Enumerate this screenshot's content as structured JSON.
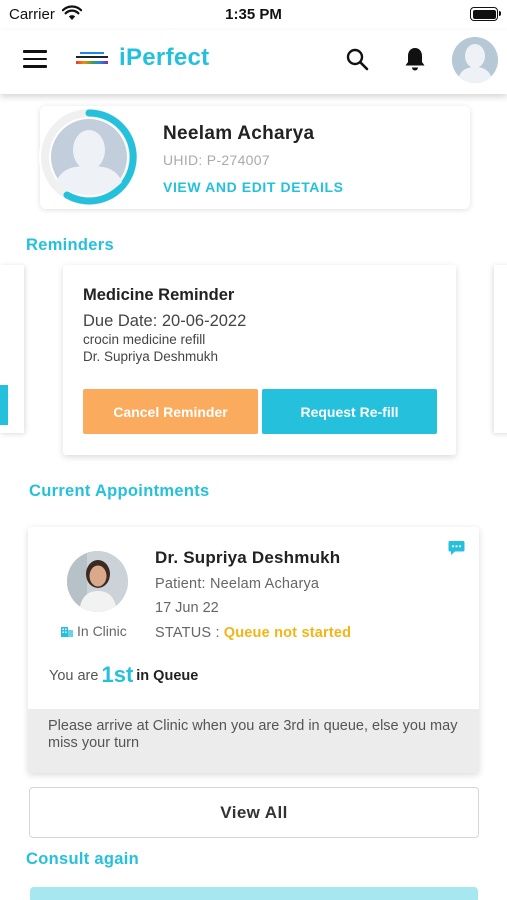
{
  "status_bar": {
    "carrier": "Carrier",
    "time": "1:35 PM"
  },
  "header": {
    "app_name": "iPerfect"
  },
  "profile": {
    "name": "Neelam Acharya",
    "uhid": "UHID: P-274007",
    "edit_link": "VIEW AND EDIT DETAILS"
  },
  "reminders": {
    "section_title": "Reminders",
    "card": {
      "title": "Medicine Reminder",
      "due_date": "Due Date: 20-06-2022",
      "description": "crocin medicine refill",
      "doctor": "Dr. Supriya Deshmukh",
      "cancel_label": "Cancel Reminder",
      "refill_label": "Request Re-fill"
    }
  },
  "appointments": {
    "section_title": "Current Appointments",
    "card": {
      "doctor": "Dr. Supriya Deshmukh",
      "patient": "Patient: Neelam Acharya",
      "date": "17 Jun 22",
      "status_label": "STATUS :",
      "status_value": "Queue not started",
      "mode": "In Clinic",
      "queue_prefix": "You are",
      "queue_position": "1st",
      "queue_suffix": "in Queue",
      "notice": "Please arrive at Clinic when you are 3rd in queue, else you may miss your turn"
    },
    "view_all_label": "View All"
  },
  "consult_again": {
    "section_title": "Consult again"
  },
  "colors": {
    "accent": "#25c1dc",
    "cancel_button": "#fbab5d",
    "status_warning": "#f3b516"
  },
  "icons": [
    "menu-icon",
    "search-icon",
    "bell-icon",
    "chat-icon",
    "building-icon",
    "wifi-icon",
    "battery-icon"
  ]
}
